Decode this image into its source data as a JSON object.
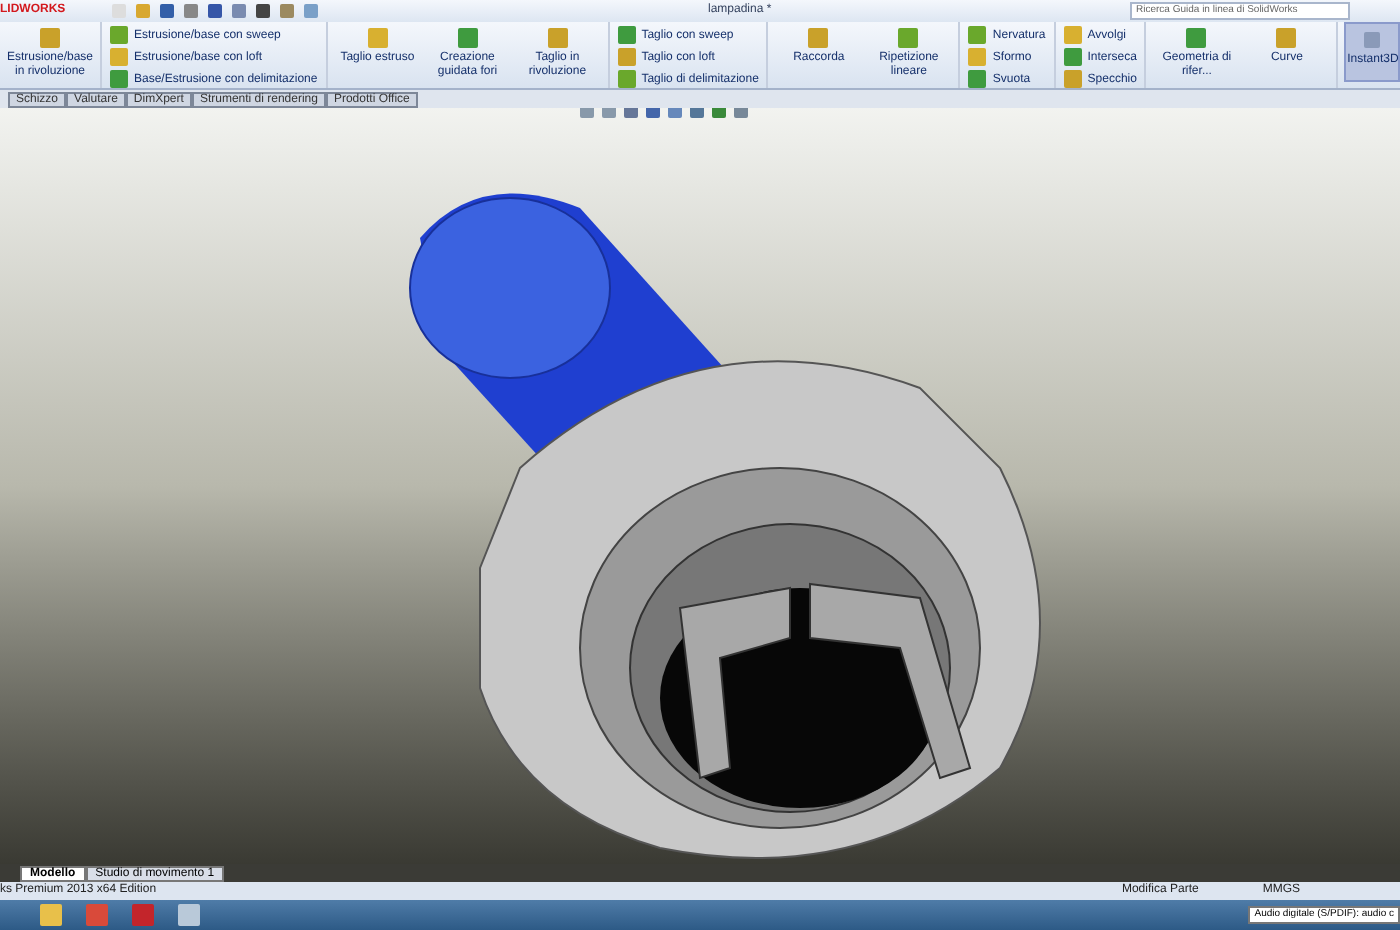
{
  "window": {
    "logo": "LIDWORKS",
    "title": "lampadina *",
    "search": {
      "placeholder": "Ricerca Guida in linea di SolidWorks"
    }
  },
  "ribbon": {
    "groups": [
      {
        "kind": "big",
        "items": [
          {
            "label": "Estrusione/base in rivoluzione"
          }
        ]
      },
      {
        "kind": "small",
        "items": [
          {
            "label": "Estrusione/base con sweep"
          },
          {
            "label": "Estrusione/base con loft"
          },
          {
            "label": "Base/Estrusione con delimitazione"
          }
        ]
      },
      {
        "kind": "big",
        "items": [
          {
            "label": "Taglio estruso"
          },
          {
            "label": "Creazione guidata fori"
          },
          {
            "label": "Taglio in rivoluzione"
          }
        ]
      },
      {
        "kind": "small",
        "items": [
          {
            "label": "Taglio con sweep"
          },
          {
            "label": "Taglio con loft"
          },
          {
            "label": "Taglio di delimitazione"
          }
        ]
      },
      {
        "kind": "big",
        "items": [
          {
            "label": "Raccorda"
          },
          {
            "label": "Ripetizione lineare"
          }
        ]
      },
      {
        "kind": "small",
        "items": [
          {
            "label": "Nervatura"
          },
          {
            "label": "Sformo"
          },
          {
            "label": "Svuota"
          }
        ]
      },
      {
        "kind": "small",
        "items": [
          {
            "label": "Avvolgi"
          },
          {
            "label": "Interseca"
          },
          {
            "label": "Specchio"
          }
        ]
      },
      {
        "kind": "big",
        "items": [
          {
            "label": "Geometria di rifer..."
          },
          {
            "label": "Curve"
          }
        ]
      },
      {
        "kind": "toggle",
        "items": [
          {
            "label": "Instant3D",
            "selected": true
          }
        ]
      }
    ]
  },
  "tabs": [
    {
      "label": "Schizzo",
      "selected": false
    },
    {
      "label": "Valutare",
      "selected": false
    },
    {
      "label": "DimXpert",
      "selected": false
    },
    {
      "label": "Strumenti di rendering",
      "selected": false
    },
    {
      "label": "Prodotti Office",
      "selected": false
    }
  ],
  "bottom_tabs": [
    {
      "label": "Modello",
      "selected": true
    },
    {
      "label": "Studio di movimento 1",
      "selected": false
    }
  ],
  "status_bar": {
    "edition": "ks Premium 2013 x64 Edition",
    "mode": "Modifica Parte",
    "units": "MMGS"
  },
  "taskbar": {
    "tray_tooltip": "Audio digitale (S/PDIF): audio c"
  }
}
